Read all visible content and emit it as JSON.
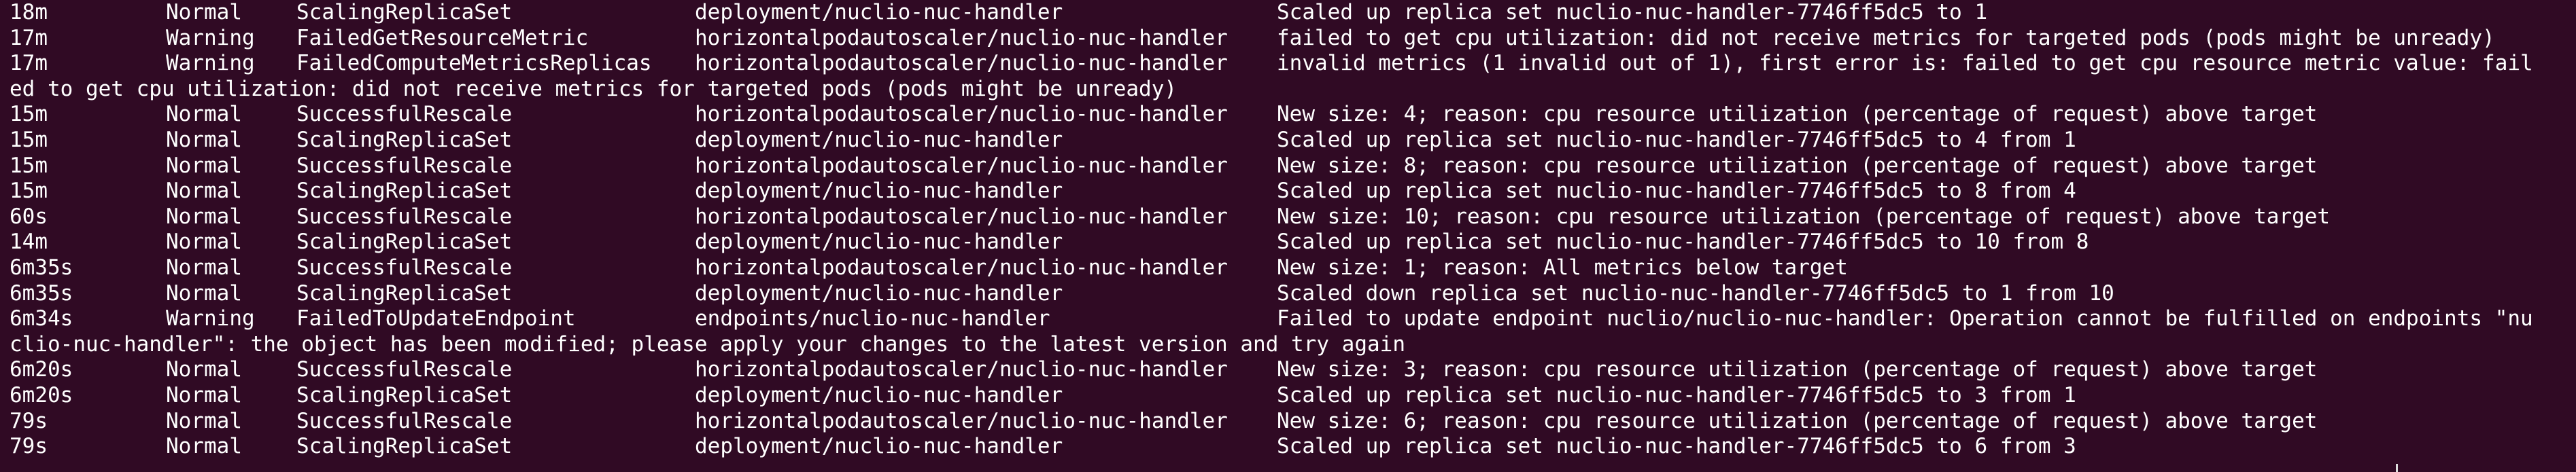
{
  "terminal": {
    "rows": [
      {
        "age": "18m",
        "type": "Normal",
        "reason": "ScalingReplicaSet",
        "object": "deployment/nuclio-nuc-handler",
        "message": "Scaled up replica set nuclio-nuc-handler-7746ff5dc5 to 1"
      },
      {
        "age": "17m",
        "type": "Warning",
        "reason": "FailedGetResourceMetric",
        "object": "horizontalpodautoscaler/nuclio-nuc-handler",
        "message": "failed to get cpu utilization: did not receive metrics for targeted pods (pods might be unready)"
      },
      {
        "age": "17m",
        "type": "Warning",
        "reason": "FailedComputeMetricsReplicas",
        "object": "horizontalpodautoscaler/nuclio-nuc-handler",
        "message": "invalid metrics (1 invalid out of 1), first error is: failed to get cpu resource metric value: fail"
      },
      {
        "wrap": "ed to get cpu utilization: did not receive metrics for targeted pods (pods might be unready)"
      },
      {
        "age": "15m",
        "type": "Normal",
        "reason": "SuccessfulRescale",
        "object": "horizontalpodautoscaler/nuclio-nuc-handler",
        "message": "New size: 4; reason: cpu resource utilization (percentage of request) above target"
      },
      {
        "age": "15m",
        "type": "Normal",
        "reason": "ScalingReplicaSet",
        "object": "deployment/nuclio-nuc-handler",
        "message": "Scaled up replica set nuclio-nuc-handler-7746ff5dc5 to 4 from 1"
      },
      {
        "age": "15m",
        "type": "Normal",
        "reason": "SuccessfulRescale",
        "object": "horizontalpodautoscaler/nuclio-nuc-handler",
        "message": "New size: 8; reason: cpu resource utilization (percentage of request) above target"
      },
      {
        "age": "15m",
        "type": "Normal",
        "reason": "ScalingReplicaSet",
        "object": "deployment/nuclio-nuc-handler",
        "message": "Scaled up replica set nuclio-nuc-handler-7746ff5dc5 to 8 from 4"
      },
      {
        "age": "60s",
        "type": "Normal",
        "reason": "SuccessfulRescale",
        "object": "horizontalpodautoscaler/nuclio-nuc-handler",
        "message": "New size: 10; reason: cpu resource utilization (percentage of request) above target"
      },
      {
        "age": "14m",
        "type": "Normal",
        "reason": "ScalingReplicaSet",
        "object": "deployment/nuclio-nuc-handler",
        "message": "Scaled up replica set nuclio-nuc-handler-7746ff5dc5 to 10 from 8"
      },
      {
        "age": "6m35s",
        "type": "Normal",
        "reason": "SuccessfulRescale",
        "object": "horizontalpodautoscaler/nuclio-nuc-handler",
        "message": "New size: 1; reason: All metrics below target"
      },
      {
        "age": "6m35s",
        "type": "Normal",
        "reason": "ScalingReplicaSet",
        "object": "deployment/nuclio-nuc-handler",
        "message": "Scaled down replica set nuclio-nuc-handler-7746ff5dc5 to 1 from 10"
      },
      {
        "age": "6m34s",
        "type": "Warning",
        "reason": "FailedToUpdateEndpoint",
        "object": "endpoints/nuclio-nuc-handler",
        "message": "Failed to update endpoint nuclio/nuclio-nuc-handler: Operation cannot be fulfilled on endpoints \"nu"
      },
      {
        "wrap": "clio-nuc-handler\": the object has been modified; please apply your changes to the latest version and try again"
      },
      {
        "age": "6m20s",
        "type": "Normal",
        "reason": "SuccessfulRescale",
        "object": "horizontalpodautoscaler/nuclio-nuc-handler",
        "message": "New size: 3; reason: cpu resource utilization (percentage of request) above target"
      },
      {
        "age": "6m20s",
        "type": "Normal",
        "reason": "ScalingReplicaSet",
        "object": "deployment/nuclio-nuc-handler",
        "message": "Scaled up replica set nuclio-nuc-handler-7746ff5dc5 to 3 from 1"
      },
      {
        "age": "79s",
        "type": "Normal",
        "reason": "SuccessfulRescale",
        "object": "horizontalpodautoscaler/nuclio-nuc-handler",
        "message": "New size: 6; reason: cpu resource utilization (percentage of request) above target"
      },
      {
        "age": "79s",
        "type": "Normal",
        "reason": "ScalingReplicaSet",
        "object": "deployment/nuclio-nuc-handler",
        "message": "Scaled up replica set nuclio-nuc-handler-7746ff5dc5 to 6 from 3"
      }
    ]
  },
  "colors": {
    "background": "#300a24",
    "foreground": "#ffffff"
  }
}
